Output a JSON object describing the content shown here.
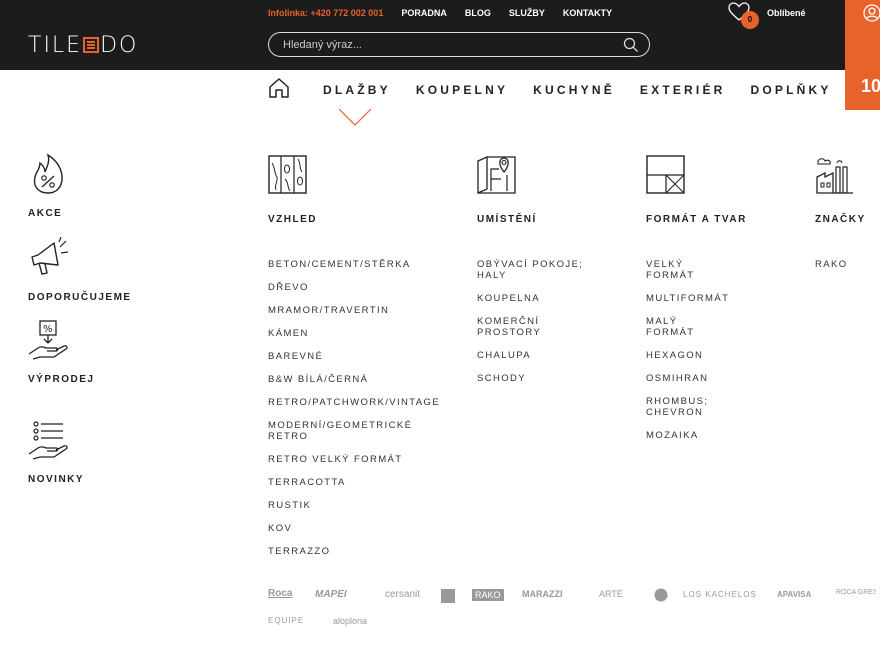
{
  "brand": {
    "logo_left": "TILE",
    "logo_right": "DO"
  },
  "topbar": {
    "phone": "Infolinka: +420 772 002 001",
    "links": [
      "PORADNA",
      "BLOG",
      "SLUŽBY",
      "KONTAKTY"
    ]
  },
  "search": {
    "placeholder": "Hledaný výraz..."
  },
  "favorites": {
    "count": "0",
    "label": "Oblíbené"
  },
  "cart_partial": "10",
  "nav": {
    "items": [
      "DLAŽBY",
      "KOUPELNY",
      "KUCHYNĚ",
      "EXTERIÉR",
      "DOPLŇKY"
    ],
    "active": "DLAŽBY"
  },
  "sidebar": [
    {
      "label": "AKCE",
      "icon": "flame-percent-icon"
    },
    {
      "label": "DOPORUČUJEME",
      "icon": "megaphone-icon"
    },
    {
      "label": "VÝPRODEJ",
      "icon": "hand-percent-icon"
    },
    {
      "label": "NOVINKY",
      "icon": "hand-list-icon"
    }
  ],
  "columns": [
    {
      "title": "VZHLED",
      "icon": "wood-texture-icon",
      "items": [
        "BETON/CEMENT/STĚRKA",
        "DŘEVO",
        "MRAMOR/TRAVERTIN",
        "KÁMEN",
        "BAREVNÉ",
        "B&W BÍLÁ/ČERNÁ",
        "RETRO/PATCHWORK/VINTAGE",
        "MODERNÍ/GEOMETRICKÉ RETRO",
        "RETRO VELKÝ FORMÁT",
        "TERRACOTTA",
        "RUSTIK",
        "KOV",
        "TERRAZZO"
      ]
    },
    {
      "title": "UMÍSTĚNÍ",
      "icon": "floor-plan-pin-icon",
      "items": [
        "OBÝVACÍ POKOJE; HALY",
        "KOUPELNA",
        "KOMERČNÍ PROSTORY",
        "CHALUPA",
        "SCHODY"
      ]
    },
    {
      "title": "FORMÁT A TVAR",
      "icon": "tile-format-icon",
      "items": [
        "VELKÝ FORMÁT",
        "MULTIFORMÁT",
        "MALÝ FORMÁT",
        "HEXAGON",
        "OSMIHRAN",
        "RHOMBUS; CHEVRON",
        "MOZAIKA"
      ]
    },
    {
      "title": "ZNAČKY",
      "icon": "factory-icon",
      "items": [
        "RAKO"
      ]
    }
  ],
  "brands": [
    "Roca",
    "MAPEI",
    "cersanit",
    "RAKO",
    "MARAZZI",
    "ARTÉ",
    "LOS KACHELOS",
    "APAVISA",
    "ROCA GRES",
    "EQUIPE",
    "aloplona"
  ],
  "colors": {
    "header_bg": "#1c1c1c",
    "accent": "#e8622c",
    "text": "#222222"
  }
}
